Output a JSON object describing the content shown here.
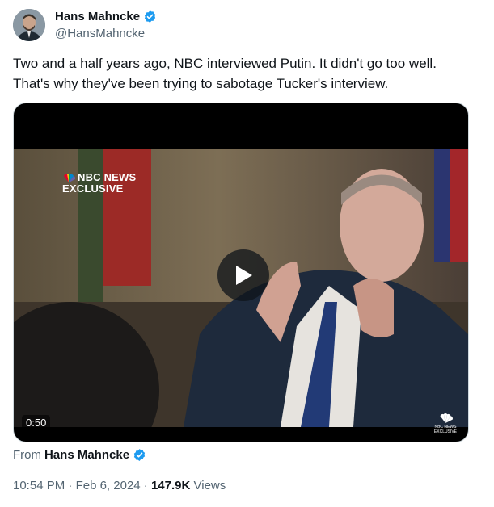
{
  "author": {
    "display_name": "Hans Mahncke",
    "handle": "@HansMahncke"
  },
  "tweet": {
    "text": "Two and a half years ago, NBC interviewed Putin. It didn't go too well. That's why they've been trying to sabotage Tucker's interview."
  },
  "video": {
    "overlay_line1": "NBC NEWS",
    "overlay_line2": "EXCLUSIVE",
    "duration": "0:50",
    "corner_logo_line1": "NBC NEWS",
    "corner_logo_line2": "EXCLUSIVE"
  },
  "source": {
    "prefix": "From",
    "name": "Hans Mahncke"
  },
  "meta": {
    "time": "10:54 PM",
    "separator": "·",
    "date": "Feb 6, 2024",
    "views_count": "147.9K",
    "views_label": "Views"
  },
  "colors": {
    "verified_blue": "#1d9bf0",
    "secondary_text": "#536471",
    "primary_text": "#0f1419"
  }
}
